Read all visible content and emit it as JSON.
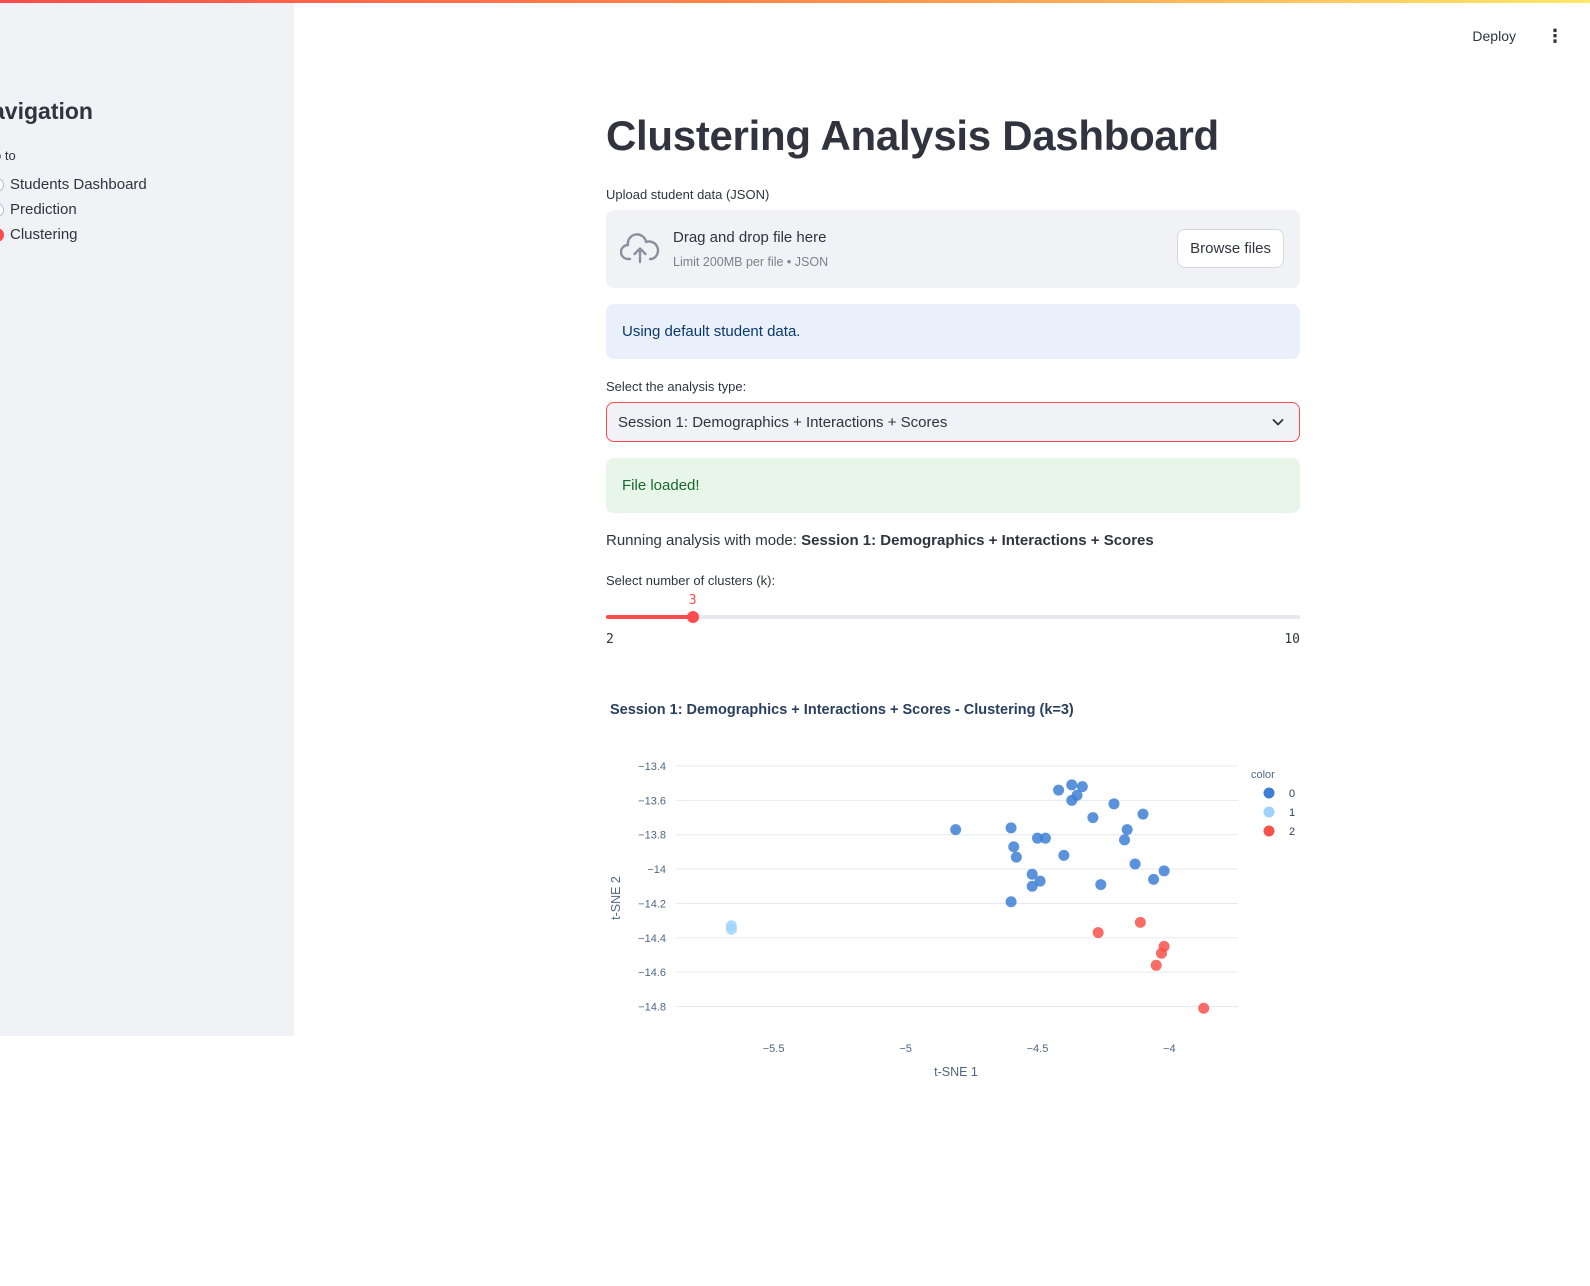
{
  "sidebar": {
    "title": "avigation",
    "goto_label": "o to",
    "items": [
      {
        "label": "Students Dashboard",
        "selected": false
      },
      {
        "label": "Prediction",
        "selected": false
      },
      {
        "label": "Clustering",
        "selected": true
      }
    ]
  },
  "header": {
    "deploy_label": "Deploy",
    "menu_icon": "⋮"
  },
  "main": {
    "title": "Clustering Analysis Dashboard",
    "upload_label": "Upload student data (JSON)",
    "uploader": {
      "drop_text": "Drag and drop file here",
      "limit_text": "Limit 200MB per file • JSON",
      "browse_label": "Browse files",
      "icon": "cloud-upload-icon"
    },
    "info_message": "Using default student data.",
    "analysis_label": "Select the analysis type:",
    "analysis_selected": "Session 1: Demographics + Interactions + Scores",
    "success_message": "File loaded!",
    "run_prefix": "Running analysis with mode:",
    "run_mode": "Session 1: Demographics + Interactions + Scores",
    "slider": {
      "label": "Select number of clusters (k):",
      "value": 3,
      "min": 2,
      "max": 10
    }
  },
  "colors": {
    "accent": "#ff4b4b",
    "cluster0": "#3d7fd6",
    "cluster1": "#9fd3ff",
    "cluster2": "#f8514a"
  },
  "chart_data": {
    "type": "scatter",
    "title": "Session 1: Demographics + Interactions + Scores - Clustering (k=3)",
    "xlabel": "t-SNE 1",
    "ylabel": "t-SNE 2",
    "xlim": [
      -5.87,
      -3.74
    ],
    "ylim": [
      -14.89,
      -13.33
    ],
    "xticks": [
      -5.5,
      -5,
      -4.5,
      -4
    ],
    "xtick_labels": [
      "−5.5",
      "−5",
      "−4.5",
      "−4"
    ],
    "yticks": [
      -13.4,
      -13.6,
      -13.8,
      -14,
      -14.2,
      -14.4,
      -14.6,
      -14.8
    ],
    "ytick_labels": [
      "−13.4",
      "−13.6",
      "−13.8",
      "−14",
      "−14.2",
      "−14.4",
      "−14.6",
      "−14.8"
    ],
    "grid": true,
    "legend": {
      "title": "color",
      "position": "right"
    },
    "series": [
      {
        "name": "0",
        "color": "#3d7fd6",
        "points": [
          [
            -4.42,
            -13.54
          ],
          [
            -4.37,
            -13.51
          ],
          [
            -4.35,
            -13.57
          ],
          [
            -4.33,
            -13.52
          ],
          [
            -4.37,
            -13.6
          ],
          [
            -4.21,
            -13.62
          ],
          [
            -4.29,
            -13.7
          ],
          [
            -4.1,
            -13.68
          ],
          [
            -4.16,
            -13.77
          ],
          [
            -4.17,
            -13.83
          ],
          [
            -4.81,
            -13.77
          ],
          [
            -4.6,
            -13.76
          ],
          [
            -4.5,
            -13.82
          ],
          [
            -4.47,
            -13.82
          ],
          [
            -4.59,
            -13.87
          ],
          [
            -4.58,
            -13.93
          ],
          [
            -4.4,
            -13.92
          ],
          [
            -4.13,
            -13.97
          ],
          [
            -4.02,
            -14.01
          ],
          [
            -4.06,
            -14.06
          ],
          [
            -4.52,
            -14.03
          ],
          [
            -4.49,
            -14.07
          ],
          [
            -4.52,
            -14.1
          ],
          [
            -4.26,
            -14.09
          ],
          [
            -4.6,
            -14.19
          ]
        ]
      },
      {
        "name": "1",
        "color": "#9fd3ff",
        "points": [
          [
            -5.66,
            -14.33
          ],
          [
            -5.66,
            -14.35
          ]
        ]
      },
      {
        "name": "2",
        "color": "#f8514a",
        "points": [
          [
            -4.11,
            -14.31
          ],
          [
            -4.27,
            -14.37
          ],
          [
            -4.02,
            -14.45
          ],
          [
            -4.03,
            -14.49
          ],
          [
            -4.05,
            -14.56
          ],
          [
            -3.87,
            -14.81
          ]
        ]
      }
    ]
  }
}
